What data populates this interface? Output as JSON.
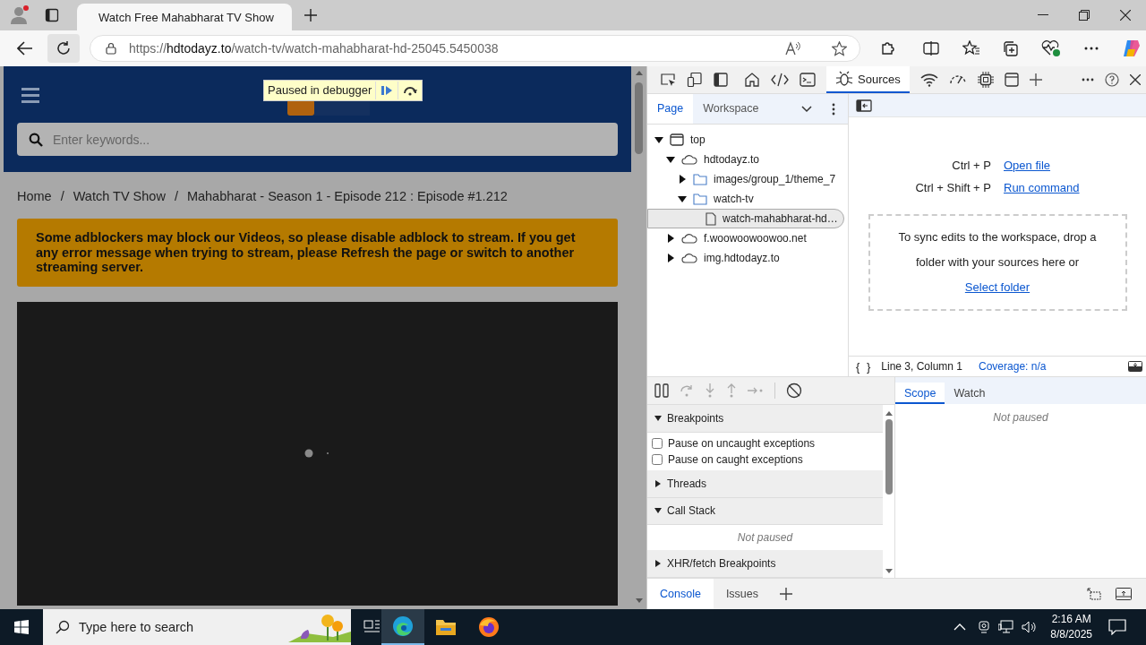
{
  "browser": {
    "tab": {
      "title": "Watch Free Mahabharat TV Show"
    },
    "address": {
      "scheme": "https://",
      "host": "hdtodayz.to",
      "path": "/watch-tv/watch-mahabharat-hd-25045.5450038"
    }
  },
  "page": {
    "debugger_badge": "Paused in debugger",
    "search": {
      "placeholder": "Enter keywords..."
    },
    "breadcrumb": [
      {
        "label": "Home",
        "separator": "/"
      },
      {
        "label": "Watch TV Show",
        "separator": "/"
      },
      {
        "label": "Mahabharat - Season 1 - Episode 212 : Episode #1.212"
      }
    ],
    "notice": "Some adblockers may block our Videos, so please disable adblock to stream. If you get any error message when trying to stream, please Refresh the page or switch to another streaming server."
  },
  "devtools": {
    "panel_tab": {
      "label": "Sources",
      "selected": true
    },
    "navigator_tabs": [
      {
        "label": "Page",
        "selected": true
      },
      {
        "label": "Workspace",
        "selected": false
      }
    ],
    "tree": [
      {
        "label": "top",
        "kind": "frame",
        "expanded": true,
        "children": [
          {
            "label": "hdtodayz.to",
            "kind": "domain",
            "expanded": true,
            "children": [
              {
                "label": "images/group_1/theme_7",
                "kind": "folder",
                "expanded": false
              },
              {
                "label": "watch-tv",
                "kind": "folder",
                "expanded": true,
                "children": [
                  {
                    "label": "watch-mahabharat-hd…",
                    "kind": "file",
                    "selected": true
                  }
                ]
              }
            ]
          },
          {
            "label": "f.woowoowoowoo.net",
            "kind": "domain",
            "expanded": false
          },
          {
            "label": "img.hdtodayz.to",
            "kind": "domain",
            "expanded": false
          }
        ]
      }
    ],
    "shortcuts": [
      {
        "keys": "Ctrl + P",
        "action": "Open file"
      },
      {
        "keys": "Ctrl + Shift + P",
        "action": "Run command"
      }
    ],
    "drop_zone": {
      "text": "To sync edits to the workspace, drop a folder with your sources here or",
      "link": "Select folder"
    },
    "status": {
      "format": "{ }",
      "position": "Line 3, Column 1",
      "coverage": "Coverage: n/a"
    },
    "sections": [
      {
        "title": "Breakpoints",
        "expanded": true,
        "kind": "checkboxes",
        "items": [
          {
            "label": "Pause on uncaught exceptions",
            "checked": false
          },
          {
            "label": "Pause on caught exceptions",
            "checked": false
          }
        ]
      },
      {
        "title": "Threads",
        "expanded": false
      },
      {
        "title": "Call Stack",
        "expanded": true,
        "kind": "message",
        "message": "Not paused"
      },
      {
        "title": "XHR/fetch Breakpoints",
        "expanded": false
      }
    ],
    "scope_tabs": [
      {
        "label": "Scope",
        "selected": true
      },
      {
        "label": "Watch",
        "selected": false
      }
    ],
    "scope_message": "Not paused",
    "drawer_tabs": [
      {
        "label": "Console",
        "selected": true
      },
      {
        "label": "Issues",
        "selected": false
      }
    ]
  },
  "taskbar": {
    "search": {
      "placeholder": "Type here to search"
    },
    "time": "2:16 AM",
    "date": "8/8/2025"
  }
}
